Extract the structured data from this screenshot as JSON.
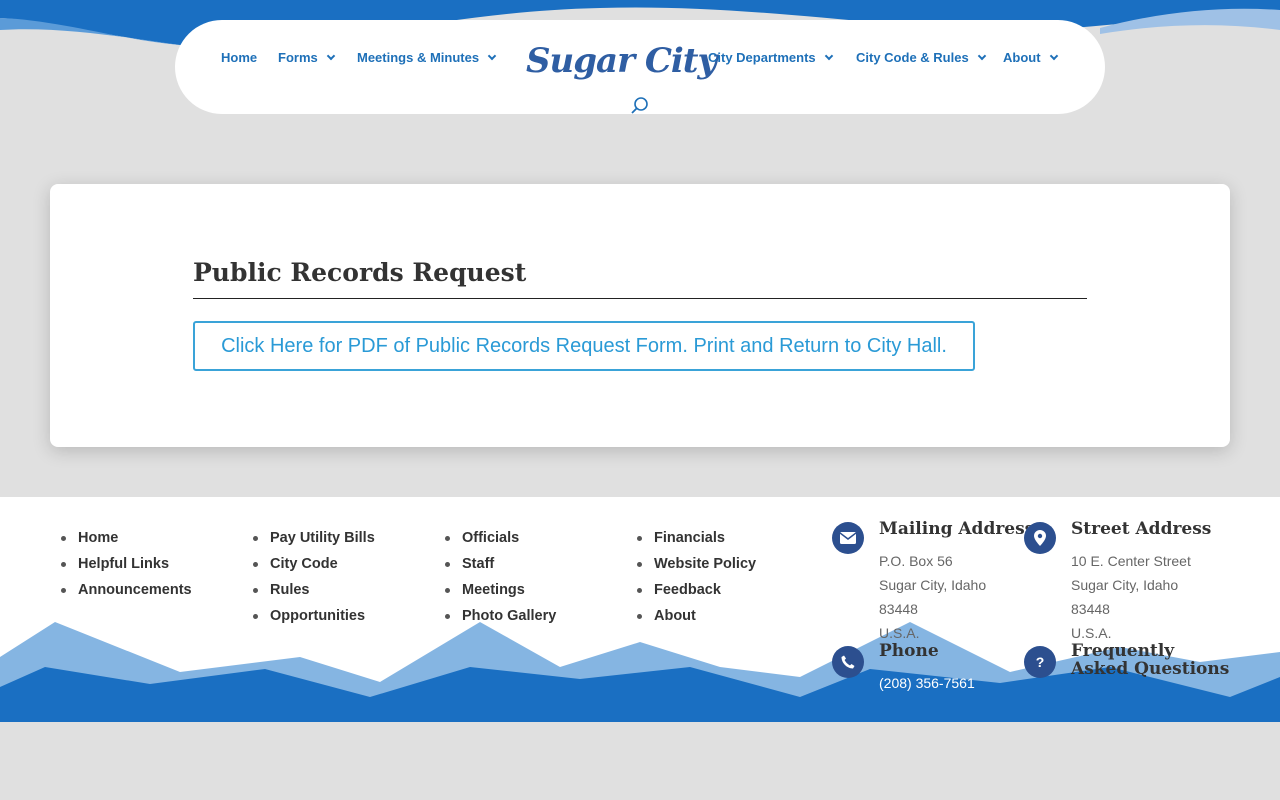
{
  "nav": {
    "left": [
      {
        "label": "Home",
        "has_dropdown": false
      },
      {
        "label": "Forms",
        "has_dropdown": true
      },
      {
        "label": "Meetings & Minutes",
        "has_dropdown": true
      }
    ],
    "right": [
      {
        "label": "City Departments",
        "has_dropdown": true
      },
      {
        "label": "City Code & Rules",
        "has_dropdown": true
      },
      {
        "label": "About",
        "has_dropdown": true
      }
    ],
    "logo_text": "Sugar City"
  },
  "main": {
    "title": "Public Records Request",
    "pdf_button_label": "Click Here for PDF of Public Records Request Form. Print and Return to City Hall."
  },
  "footer": {
    "columns": [
      [
        "Home",
        "Helpful Links",
        "Announcements"
      ],
      [
        "Pay Utility Bills",
        "City Code",
        "Rules",
        "Opportunities"
      ],
      [
        "Officials",
        "Staff",
        "Meetings",
        "Photo Gallery"
      ],
      [
        "Financials",
        "Website Policy",
        "Feedback",
        "About"
      ]
    ],
    "mailing": {
      "title": "Mailing Address",
      "lines": [
        "P.O. Box 56",
        "Sugar City, Idaho",
        "83448",
        "U.S.A."
      ]
    },
    "street": {
      "title": "Street Address",
      "lines": [
        "10 E. Center Street",
        "Sugar City, Idaho",
        "83448",
        "U.S.A."
      ]
    },
    "phone": {
      "title": "Phone",
      "number": "(208) 356-7561"
    },
    "faq": {
      "title_line1": "Frequently",
      "title_line2": "Asked Questions"
    }
  },
  "colors": {
    "brand_blue": "#1e70b8",
    "dark_blue": "#2c4f8f",
    "link_blue": "#2a9ad6",
    "background": "#e0e0e0"
  },
  "icons": [
    "search-icon",
    "envelope-icon",
    "map-pin-icon",
    "phone-icon",
    "question-icon",
    "chevron-down-icon"
  ]
}
